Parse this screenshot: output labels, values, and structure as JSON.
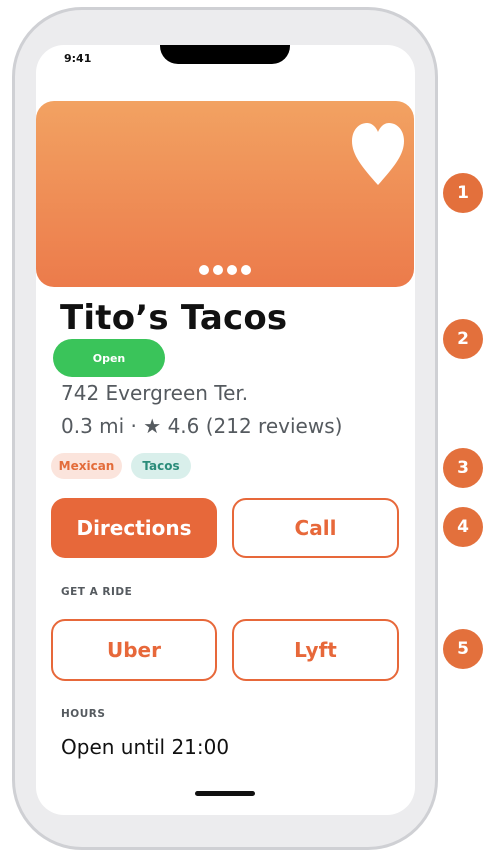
{
  "status_bar": {
    "time": "9:41"
  },
  "hero": {
    "favorite_icon": "heart-icon",
    "carousel_dot_count": 4
  },
  "place": {
    "name": "Tito’s Tacos",
    "status": "Open",
    "address": "742 Evergreen Ter.",
    "meta": "0.3 mi · ★ 4.6 (212 reviews)",
    "tags": [
      "Mexican",
      "Tacos"
    ]
  },
  "actions": {
    "directions_label": "Directions",
    "call_label": "Call"
  },
  "ride": {
    "section_label": "GET A RIDE",
    "uber_label": "Uber",
    "lyft_label": "Lyft"
  },
  "hours": {
    "section_label": "HOURS",
    "text": "Open until 21:00"
  },
  "markers": [
    "1",
    "2",
    "3",
    "4",
    "5"
  ],
  "colors": {
    "accent": "#e7683a",
    "open_green": "#3ac45a",
    "hero_top": "#f2a262",
    "hero_bottom": "#ec7b4b",
    "tag_mexican_bg": "#fbe4dc",
    "tag_tacos_bg": "#d9efeb"
  }
}
